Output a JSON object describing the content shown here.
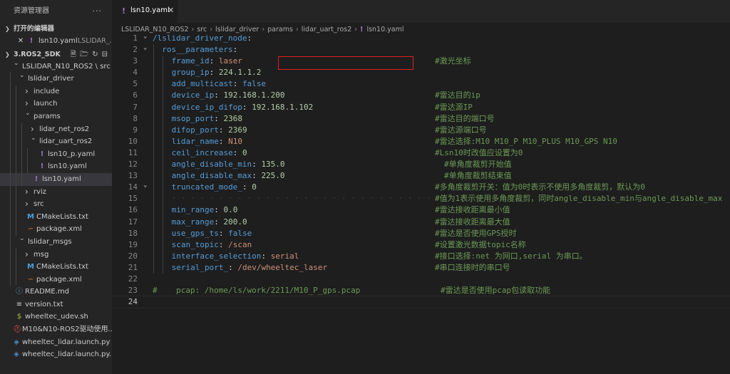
{
  "explorer": {
    "title": "资源管理器",
    "more": "···",
    "open_editors_label": "打开的编辑器",
    "open_editor_item": {
      "icon": "✕",
      "name": "lsn10.yaml",
      "path": "LSLIDAR_..."
    },
    "workspace_label": "3.ROS2_SDK",
    "actions": [
      "new-file-icon",
      "new-folder-icon",
      "refresh-icon",
      "collapse-all-icon"
    ],
    "tree": [
      {
        "name": "LSLIDAR_N10_ROS2 \\ src",
        "kind": "folder",
        "open": true,
        "depth": 1
      },
      {
        "name": "lslidar_driver",
        "kind": "folder",
        "open": true,
        "depth": 2,
        "active": true
      },
      {
        "name": "include",
        "kind": "folder",
        "open": false,
        "depth": 3
      },
      {
        "name": "launch",
        "kind": "folder",
        "open": false,
        "depth": 3
      },
      {
        "name": "params",
        "kind": "folder",
        "open": true,
        "depth": 3
      },
      {
        "name": "lidar_net_ros2",
        "kind": "folder",
        "open": false,
        "depth": 4
      },
      {
        "name": "lidar_uart_ros2",
        "kind": "folder",
        "open": true,
        "depth": 4
      },
      {
        "name": "lsn10_p.yaml",
        "kind": "yaml",
        "depth": 5
      },
      {
        "name": "lsn10.yaml",
        "kind": "yaml",
        "depth": 5
      },
      {
        "name": "lsn10.yaml",
        "kind": "yaml",
        "depth": 4,
        "selected": true
      },
      {
        "name": "rviz",
        "kind": "folder",
        "open": false,
        "depth": 3
      },
      {
        "name": "src",
        "kind": "folder",
        "open": false,
        "depth": 3
      },
      {
        "name": "CMakeLists.txt",
        "kind": "cmake",
        "depth": 3
      },
      {
        "name": "package.xml",
        "kind": "rss",
        "depth": 3
      },
      {
        "name": "lslidar_msgs",
        "kind": "folder",
        "open": true,
        "depth": 2
      },
      {
        "name": "msg",
        "kind": "folder",
        "open": false,
        "depth": 3
      },
      {
        "name": "CMakeLists.txt",
        "kind": "cmake",
        "depth": 3
      },
      {
        "name": "package.xml",
        "kind": "rss",
        "depth": 3
      },
      {
        "name": "README.md",
        "kind": "info",
        "depth": 1
      },
      {
        "name": "version.txt",
        "kind": "txt",
        "depth": 1
      },
      {
        "name": "wheeltec_udev.sh",
        "kind": "sh",
        "depth": 1
      },
      {
        "name": "M10&N10-ROS2驱动使用...",
        "kind": "pdf",
        "depth": 0
      },
      {
        "name": "wheeltec_lidar.launch.py",
        "kind": "py",
        "depth": 0
      },
      {
        "name": "wheeltec_lidar.launch.py...",
        "kind": "py",
        "depth": 0
      }
    ]
  },
  "tab": {
    "label": "lsn10.yaml",
    "close": "✕"
  },
  "breadcrumb": [
    "LSLIDAR_N10_ROS2",
    "src",
    "lslidar_driver",
    "params",
    "lidar_uart_ros2",
    "lsn10.yaml"
  ],
  "code": [
    {
      "n": "1",
      "fold": "v",
      "indent": 0,
      "tokens": [
        [
          "k",
          "/lslidar_driver_node"
        ],
        [
          "p",
          ":"
        ]
      ]
    },
    {
      "n": "2",
      "fold": "v",
      "indent": 1,
      "tokens": [
        [
          "k",
          "ros__parameters"
        ],
        [
          "p",
          ":"
        ]
      ]
    },
    {
      "n": "3",
      "indent": 2,
      "tokens": [
        [
          "k",
          "frame_id"
        ],
        [
          "p",
          ": "
        ],
        [
          "s",
          "laser"
        ]
      ],
      "comment": "#激光坐标",
      "ccol": 396
    },
    {
      "n": "4",
      "indent": 2,
      "tokens": [
        [
          "k",
          "group_ip"
        ],
        [
          "p",
          ": "
        ],
        [
          "n",
          "224.1.1.2"
        ]
      ]
    },
    {
      "n": "5",
      "indent": 2,
      "tokens": [
        [
          "k",
          "add_multicast"
        ],
        [
          "p",
          ": "
        ],
        [
          "k",
          "false"
        ]
      ]
    },
    {
      "n": "6",
      "indent": 2,
      "tokens": [
        [
          "k",
          "device_ip"
        ],
        [
          "p",
          ": "
        ],
        [
          "n",
          "192.168.1.200"
        ]
      ],
      "comment": "#雷达目的ip",
      "ccol": 396
    },
    {
      "n": "7",
      "indent": 2,
      "tokens": [
        [
          "k",
          "device_ip_difop"
        ],
        [
          "p",
          ": "
        ],
        [
          "n",
          "192.168.1.102"
        ]
      ],
      "comment": "#雷达源IP",
      "ccol": 396
    },
    {
      "n": "8",
      "indent": 2,
      "tokens": [
        [
          "k",
          "msop_port"
        ],
        [
          "p",
          ": "
        ],
        [
          "n",
          "2368"
        ]
      ],
      "comment": "#雷达目的端口号",
      "ccol": 396
    },
    {
      "n": "9",
      "indent": 2,
      "tokens": [
        [
          "k",
          "difop_port"
        ],
        [
          "p",
          ": "
        ],
        [
          "n",
          "2369"
        ]
      ],
      "comment": "#雷达源端口号",
      "ccol": 396
    },
    {
      "n": "10",
      "indent": 2,
      "tokens": [
        [
          "k",
          "lidar_name"
        ],
        [
          "p",
          ": "
        ],
        [
          "s",
          "N10"
        ]
      ],
      "comment": "#雷达选择:M10 M10_P M10_PLUS M10_GPS N10",
      "ccol": 396
    },
    {
      "n": "11",
      "indent": 2,
      "tokens": [
        [
          "k",
          "ceil_increase"
        ],
        [
          "p",
          ": "
        ],
        [
          "n",
          "0"
        ]
      ],
      "comment": "#Lsn10时改值应设置为0",
      "ccol": 396
    },
    {
      "n": "12",
      "indent": 2,
      "tokens": [
        [
          "k",
          "angle_disable_min"
        ],
        [
          "p",
          ": "
        ],
        [
          "n",
          "135.0"
        ]
      ],
      "comment": "#单角度裁剪开始值",
      "ccol": 409
    },
    {
      "n": "13",
      "indent": 2,
      "tokens": [
        [
          "k",
          "angle_disable_max"
        ],
        [
          "p",
          ": "
        ],
        [
          "n",
          "225.0"
        ]
      ],
      "comment": "#单角度裁剪结束值",
      "ccol": 409
    },
    {
      "n": "14",
      "fold": "v",
      "indent": 2,
      "tokens": [
        [
          "k",
          "truncated_mode_"
        ],
        [
          "p",
          ": "
        ],
        [
          "n",
          "0"
        ]
      ],
      "comment": "#多角度裁剪开关：值为0时表示不使用多角度裁剪，默认为0",
      "ccol": 396
    },
    {
      "n": "15",
      "indent": 2,
      "tokens": [],
      "dots": true,
      "comment": "#值为1表示使用多角度裁剪，同时angle_disable_min与angle_disable_max",
      "ccol": 396
    },
    {
      "n": "16",
      "indent": 2,
      "tokens": [
        [
          "k",
          "min_range"
        ],
        [
          "p",
          ": "
        ],
        [
          "n",
          "0.0"
        ]
      ],
      "comment": "#雷达接收距离最小值",
      "ccol": 396
    },
    {
      "n": "17",
      "indent": 2,
      "tokens": [
        [
          "k",
          "max_range"
        ],
        [
          "p",
          ": "
        ],
        [
          "n",
          "200.0"
        ]
      ],
      "comment": "#雷达接收距离最大值",
      "ccol": 396
    },
    {
      "n": "18",
      "indent": 2,
      "tokens": [
        [
          "k",
          "use_gps_ts"
        ],
        [
          "p",
          ": "
        ],
        [
          "k",
          "false"
        ]
      ],
      "comment": "#雷达是否使用GPS授时",
      "ccol": 396
    },
    {
      "n": "19",
      "indent": 2,
      "tokens": [
        [
          "k",
          "scan_topic"
        ],
        [
          "p",
          ": "
        ],
        [
          "s",
          "/scan"
        ]
      ],
      "comment": "#设置激光数据topic名称",
      "ccol": 396
    },
    {
      "n": "20",
      "indent": 2,
      "tokens": [
        [
          "k",
          "interface_selection"
        ],
        [
          "p",
          ": "
        ],
        [
          "s",
          "serial"
        ]
      ],
      "comment": "#接口选择:net 为网口,serial 为串口。",
      "ccol": 396
    },
    {
      "n": "21",
      "indent": 2,
      "tokens": [
        [
          "k",
          "serial_port_"
        ],
        [
          "p",
          ": "
        ],
        [
          "s",
          "/dev/wheeltec_laser"
        ]
      ],
      "comment": "#串口连接时的串口号",
      "ccol": 396
    },
    {
      "n": "22",
      "indent": 0,
      "tokens": []
    },
    {
      "n": "23",
      "indent": 0,
      "tokens": [
        [
          "cm",
          "#    pcap: /home/ls/work/2211/M10_P_gps.pcap"
        ]
      ],
      "comment": "#雷达是否使用pcap包读取功能",
      "ccol": 404
    },
    {
      "n": "24",
      "indent": 0,
      "tokens": [],
      "current": true
    }
  ],
  "colors": {
    "keyword": "#569cd6",
    "string": "#ce9178",
    "number": "#b5cea8",
    "comment": "#6a9955",
    "highlight_box": "#e02020"
  }
}
